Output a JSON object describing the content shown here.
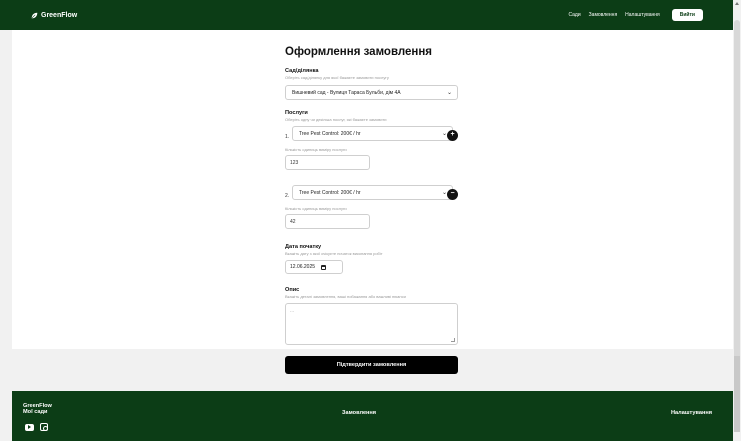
{
  "navbar": {
    "brand": "GreenFlow",
    "links": [
      "Сади",
      "Замовлення",
      "Налаштування"
    ],
    "login_label": "Вийти"
  },
  "form": {
    "title": "Оформлення замовлення",
    "garden": {
      "label": "Сад/ділянка",
      "hint": "Оберіть сад/ділянку для якої бажаєте замовити послугу",
      "selected": "Вишневий сад - Вулиця Тараса Бульби, дім 4А"
    },
    "services": {
      "label": "Послуги",
      "hint": "Оберіть одну чи декілька послуг, які бажаєте замовити",
      "items": [
        {
          "number": "1.",
          "selected": "Tree Pest Control: 200€ / hr",
          "action_icon": "plus",
          "action_symbol": "+",
          "quantity_hint": "Кількість одиниць виміру послуги",
          "quantity": "123"
        },
        {
          "number": "2.",
          "selected": "Tree Pest Control: 200€ / hr",
          "action_icon": "minus",
          "action_symbol": "−",
          "quantity_hint": "Кількість одиниць виміру послуги",
          "quantity": "42"
        }
      ]
    },
    "start_date": {
      "label": "Дата початку",
      "hint": "Вкажіть дату з якої очікуєте початок виконання робіт",
      "value": "12.06.2025"
    },
    "description": {
      "label": "Опис",
      "hint": "Вкажіть деталі замовлення, ваші побажання або важливі нюанси",
      "placeholder": "..."
    },
    "submit_label": "Підтвердити замовлення"
  },
  "footer": {
    "brand": "GreenFlow",
    "my_gardens": "Мої сади",
    "orders": "Замовлення",
    "settings": "Налаштування"
  },
  "colors": {
    "primary": "#0c3d16",
    "button": "#000000",
    "page_bg": "#f1f1f1"
  }
}
